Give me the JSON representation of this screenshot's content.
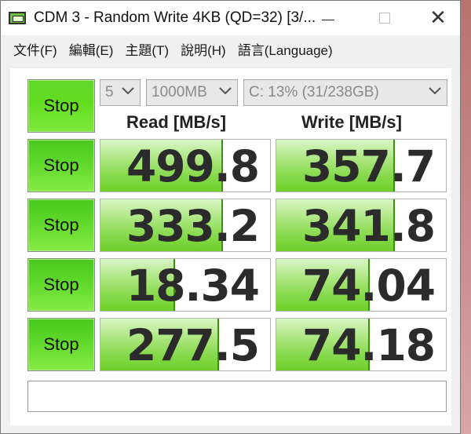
{
  "window": {
    "title": "CDM 3 - Random Write 4KB (QD=32) [3/...",
    "close_glyph": "✕"
  },
  "menu": [
    "文件(F)",
    "編輯(E)",
    "主題(T)",
    "說明(H)",
    "語言(Language)"
  ],
  "controls": {
    "all_button": "Stop",
    "count": "5",
    "size": "1000MB",
    "drive": "C: 13% (31/238GB)"
  },
  "headers": {
    "read": "Read [MB/s]",
    "write": "Write [MB/s]"
  },
  "rows": [
    {
      "button": "Stop",
      "read": "499.8",
      "write": "357.7",
      "read_fill": 0.72,
      "write_fill": 0.7
    },
    {
      "button": "Stop",
      "read": "333.2",
      "write": "341.8",
      "read_fill": 0.72,
      "write_fill": 0.7
    },
    {
      "button": "Stop",
      "read": "18.34",
      "write": "74.04",
      "read_fill": 0.44,
      "write_fill": 0.55
    },
    {
      "button": "Stop",
      "read": "277.5",
      "write": "74.18",
      "read_fill": 0.7,
      "write_fill": 0.55
    }
  ],
  "status": "",
  "colors": {
    "button_green": "#62de20",
    "bar_green": "#86d94c"
  },
  "icons": [
    "app-icon",
    "minimize-icon",
    "maximize-icon",
    "close-icon",
    "chevron-down-icon"
  ]
}
